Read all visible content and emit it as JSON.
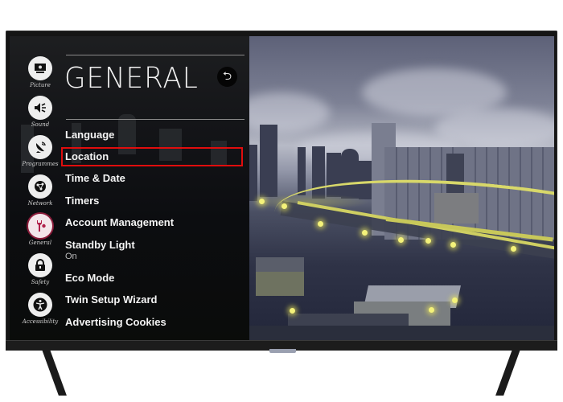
{
  "menu": {
    "title": "GENERAL",
    "back_icon": "back-arrow-icon",
    "categories": [
      {
        "label": "Picture",
        "icon": "monitor-icon",
        "glyph": "▣"
      },
      {
        "label": "Sound",
        "icon": "speaker-icon",
        "glyph": "🔈"
      },
      {
        "label": "Programmes",
        "icon": "satellite-dish-icon",
        "glyph": "📡"
      },
      {
        "label": "Network",
        "icon": "globe-network-icon",
        "glyph": "⊕"
      },
      {
        "label": "General",
        "icon": "wrench-gear-icon",
        "glyph": "🔧",
        "active": true
      },
      {
        "label": "Safety",
        "icon": "lock-icon",
        "glyph": "🔒"
      },
      {
        "label": "Accessibility",
        "icon": "accessibility-person-icon",
        "glyph": "♿"
      }
    ],
    "items": [
      {
        "label": "Language"
      },
      {
        "label": "Location",
        "highlighted": true
      },
      {
        "label": "Time & Date"
      },
      {
        "label": "Timers"
      },
      {
        "label": "Account Management"
      },
      {
        "label": "Standby Light",
        "value": "On"
      },
      {
        "label": "Eco Mode"
      },
      {
        "label": "Twin Setup Wizard"
      },
      {
        "label": "Advertising Cookies"
      }
    ]
  },
  "colors": {
    "highlight_border": "#e00d0d",
    "active_category_ring": "#8a1c3a",
    "menu_text": "#f4f4f4"
  }
}
